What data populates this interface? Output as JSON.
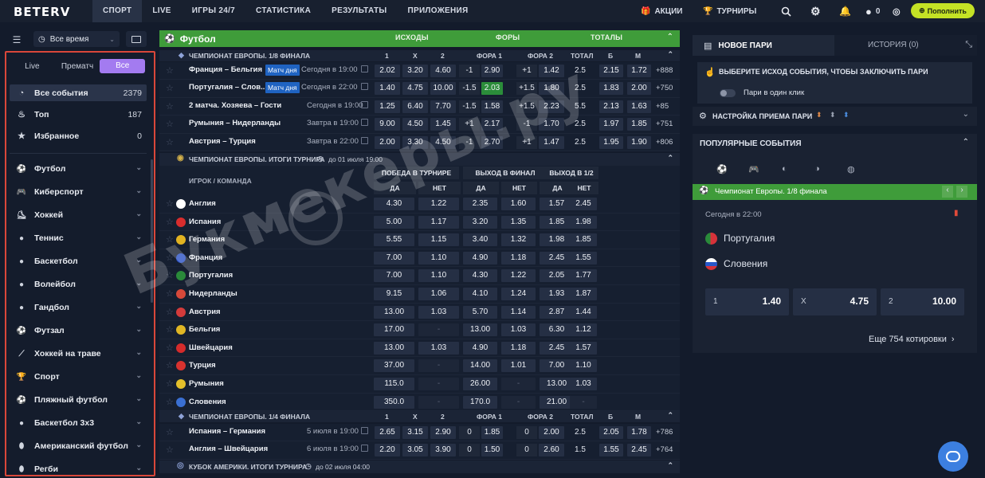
{
  "header": {
    "logo": "BETERV",
    "nav": [
      "СПОРТ",
      "LIVE",
      "ИГРЫ 24/7",
      "СТАТИСТИКА",
      "РЕЗУЛЬТАТЫ",
      "ПРИЛОЖЕНИЯ"
    ],
    "promo": "АКЦИИ",
    "tournaments": "ТУРНИРЫ",
    "balance": "0",
    "deposit": "Пополнить"
  },
  "sidebar": {
    "period": "Все время",
    "modes": [
      "Live",
      "Прематч",
      "Все"
    ],
    "active_mode": "Все",
    "top": [
      {
        "label": "Все события",
        "count": "2379"
      },
      {
        "label": "Топ",
        "count": "187"
      },
      {
        "label": "Избранное",
        "count": "0"
      }
    ],
    "sports": [
      "Футбол",
      "Киберспорт",
      "Хоккей",
      "Теннис",
      "Баскетбол",
      "Волейбол",
      "Гандбол",
      "Футзал",
      "Хоккей на траве",
      "Спорт",
      "Пляжный футбол",
      "Баскетбол 3х3",
      "Американский футбол",
      "Регби"
    ]
  },
  "main": {
    "sport": "Футбол",
    "cols": [
      "ИСХОДЫ",
      "ФОРЫ",
      "ТОТАЛЫ"
    ],
    "league1": "ЧЕМПИОНАТ ЕВРОПЫ. 1/8 ФИНАЛА",
    "h1": [
      "1",
      "X",
      "2",
      "ФОРА 1",
      "ФОРА 2",
      "ТОТАЛ",
      "Б",
      "М"
    ],
    "matches1": [
      {
        "name": "Франция – Бельгия",
        "badge": "Матч дня",
        "time": "Сегодня в 19:00",
        "o": [
          "2.02",
          "3.20",
          "4.60"
        ],
        "f1": "-1",
        "f1v": "2.90",
        "f2": "+1",
        "f2v": "1.42",
        "t": "2.5",
        "b": "2.15",
        "m": "1.72",
        "more": "+888"
      },
      {
        "name": "Португалия – Слов...",
        "badge": "Матч дня",
        "time": "Сегодня в 22:00",
        "o": [
          "1.40",
          "4.75",
          "10.00"
        ],
        "f1": "-1.5",
        "f1v": "2.03",
        "f2": "+1.5",
        "f2v": "1.80",
        "t": "2.5",
        "b": "1.83",
        "m": "2.00",
        "more": "+750"
      },
      {
        "name": "2 матча. Хозяева – Гости",
        "badge": "",
        "time": "Сегодня в 19:00",
        "o": [
          "1.25",
          "6.40",
          "7.70"
        ],
        "f1": "-1.5",
        "f1v": "1.58",
        "f2": "+1.5",
        "f2v": "2.23",
        "t": "5.5",
        "b": "2.13",
        "m": "1.63",
        "more": "+85"
      },
      {
        "name": "Румыния – Нидерланды",
        "badge": "",
        "time": "Завтра в 19:00",
        "o": [
          "9.00",
          "4.50",
          "1.45"
        ],
        "f1": "+1",
        "f1v": "2.17",
        "f2": "-1",
        "f2v": "1.70",
        "t": "2.5",
        "b": "1.97",
        "m": "1.85",
        "more": "+751"
      },
      {
        "name": "Австрия – Турция",
        "badge": "",
        "time": "Завтра в 22:00",
        "o": [
          "2.00",
          "3.30",
          "4.50"
        ],
        "f1": "-1",
        "f1v": "2.70",
        "f2": "+1",
        "f2v": "1.47",
        "t": "2.5",
        "b": "1.95",
        "m": "1.90",
        "more": "+806"
      }
    ],
    "outright": "ЧЕМПИОНАТ ЕВРОПЫ. ИТОГИ ТУРНИРА",
    "outright_date": "до 01 июля 19:00",
    "oh": [
      "ПОБЕДА В ТУРНИРЕ",
      "ВЫХОД В ФИНАЛ",
      "ВЫХОД В 1/2"
    ],
    "player_team": "ИГРОК / КОМАНДА",
    "yes": "ДА",
    "no": "НЕТ",
    "teams": [
      {
        "n": "Англия",
        "v": [
          "4.30",
          "1.22",
          "2.35",
          "1.60",
          "1.57",
          "2.45"
        ],
        "c": "#ffffff"
      },
      {
        "n": "Испания",
        "v": [
          "5.00",
          "1.17",
          "3.20",
          "1.35",
          "1.85",
          "1.98"
        ],
        "c": "#d92d2d"
      },
      {
        "n": "Германия",
        "v": [
          "5.55",
          "1.15",
          "3.40",
          "1.32",
          "1.98",
          "1.85"
        ],
        "c": "#e2b321"
      },
      {
        "n": "Франция",
        "v": [
          "7.00",
          "1.10",
          "4.90",
          "1.18",
          "2.45",
          "1.55"
        ],
        "c": "#2b52c5"
      },
      {
        "n": "Португалия",
        "v": [
          "7.00",
          "1.10",
          "4.30",
          "1.22",
          "2.05",
          "1.77"
        ],
        "c": "#2a8a3a"
      },
      {
        "n": "Нидерланды",
        "v": [
          "9.15",
          "1.06",
          "4.10",
          "1.24",
          "1.93",
          "1.87"
        ],
        "c": "#d7493a"
      },
      {
        "n": "Австрия",
        "v": [
          "13.00",
          "1.03",
          "5.70",
          "1.14",
          "2.87",
          "1.44"
        ],
        "c": "#d43b3b"
      },
      {
        "n": "Бельгия",
        "v": [
          "17.00",
          "",
          "13.00",
          "1.03",
          "6.30",
          "1.12"
        ],
        "c": "#e0b624"
      },
      {
        "n": "Швейцария",
        "v": [
          "13.00",
          "1.03",
          "4.90",
          "1.18",
          "2.45",
          "1.57"
        ],
        "c": "#d52b2b"
      },
      {
        "n": "Турция",
        "v": [
          "37.00",
          "",
          "14.00",
          "1.01",
          "7.00",
          "1.10"
        ],
        "c": "#d8322f"
      },
      {
        "n": "Румыния",
        "v": [
          "115.0",
          "",
          "26.00",
          "",
          "13.00",
          "1.03"
        ],
        "c": "#e4c02b"
      },
      {
        "n": "Словения",
        "v": [
          "350.0",
          "",
          "170.0",
          "",
          "21.00",
          ""
        ],
        "c": "#3a6fd2"
      }
    ],
    "league2": "ЧЕМПИОНАТ ЕВРОПЫ. 1/4 ФИНАЛА",
    "matches2": [
      {
        "name": "Испания – Германия",
        "time": "5 июля в 19:00",
        "o": [
          "2.65",
          "3.15",
          "2.90"
        ],
        "f1": "0",
        "f1v": "1.85",
        "f2": "0",
        "f2v": "2.00",
        "t": "2.5",
        "b": "2.05",
        "m": "1.78",
        "more": "+786"
      },
      {
        "name": "Англия – Швейцария",
        "time": "6 июля в 19:00",
        "o": [
          "2.20",
          "3.05",
          "3.90"
        ],
        "f1": "0",
        "f1v": "1.50",
        "f2": "0",
        "f2v": "2.60",
        "t": "1.5",
        "b": "1.55",
        "m": "2.45",
        "more": "+764"
      }
    ],
    "league3": "КУБОК АМЕРИКИ. ИТОГИ ТУРНИРА",
    "league3_date": "до 02 июля 04:00"
  },
  "watermark": "Букмекеры.ру",
  "right": {
    "tab1": "НОВОЕ ПАРИ",
    "tab2": "ИСТОРИЯ (0)",
    "hint": "ВЫБЕРИТЕ ИСХОД СОБЫТИЯ, ЧТОБЫ ЗАКЛЮЧИТЬ ПАРИ",
    "oneclick": "Пари в один клик",
    "settings": "НАСТРОЙКА ПРИЕМА ПАРИ",
    "popular": "ПОПУЛЯРНЫЕ СОБЫТИЯ",
    "event": "Чемпионат Европы. 1/8 финала",
    "time": "Сегодня в 22:00",
    "team1": "Португалия",
    "team2": "Словения",
    "odds": [
      {
        "l": "1",
        "v": "1.40"
      },
      {
        "l": "X",
        "v": "4.75"
      },
      {
        "l": "2",
        "v": "10.00"
      }
    ],
    "more": "Еще 754 котировки"
  }
}
